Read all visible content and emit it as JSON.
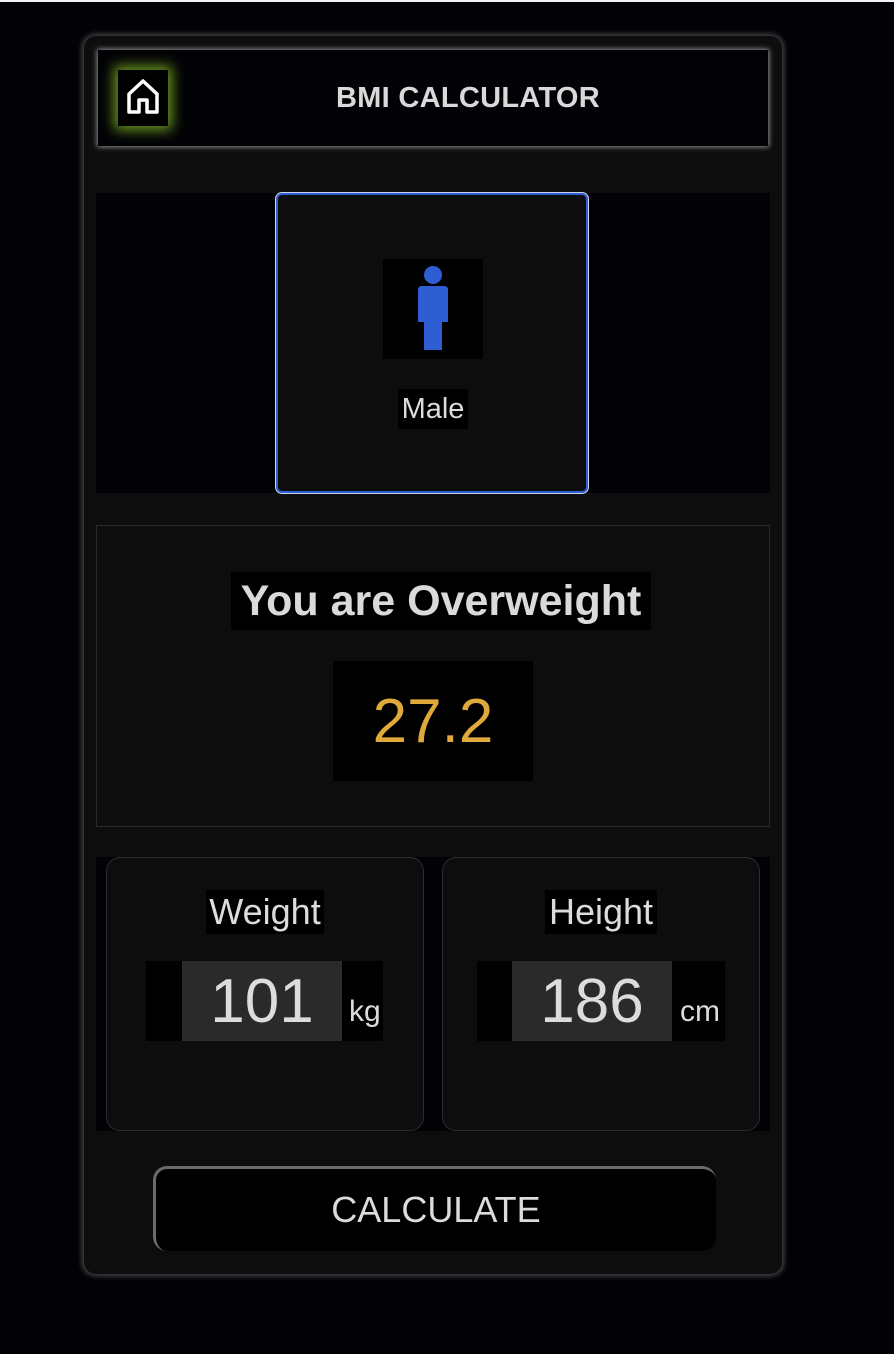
{
  "header": {
    "title": "BMI CALCULATOR",
    "home_icon": "home-icon"
  },
  "gender": {
    "selected_label": "Male",
    "icon": "male-person-icon",
    "icon_color": "#2f5ed2",
    "selected_border_color": "#2f5ed2"
  },
  "result": {
    "message": "You are Overweight",
    "bmi_value": "27.2",
    "value_color": "#e0a93b"
  },
  "weight": {
    "label": "Weight",
    "value": "101",
    "unit": "kg"
  },
  "height": {
    "label": "Height",
    "value": "186",
    "unit": "cm"
  },
  "actions": {
    "calculate_label": "CALCULATE"
  },
  "colors": {
    "home_glow": "#8cc828",
    "background": "#020206",
    "card": "#0d0d0d"
  }
}
